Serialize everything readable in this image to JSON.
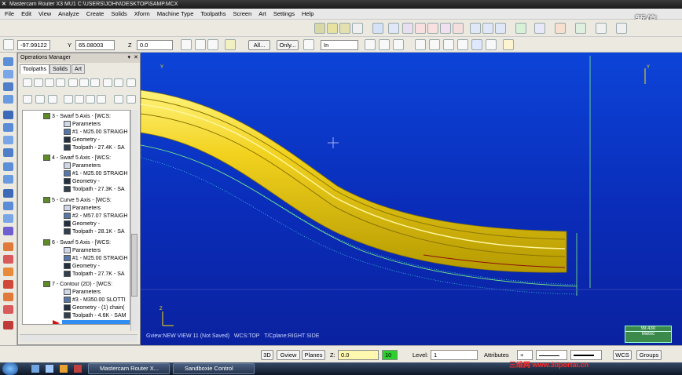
{
  "window": {
    "title": "Mastercam Router X3 MU1   C:\\USERS\\JOHN\\DESKTOP\\SAMP.MCX",
    "overlay_label": "暂停"
  },
  "menu": [
    "File",
    "Edit",
    "View",
    "Analyze",
    "Create",
    "Solids",
    "Xform",
    "Machine Type",
    "Toolpaths",
    "Screen",
    "Art",
    "Settings",
    "Help"
  ],
  "coords": {
    "x_label": "X",
    "x_value": "-97.99122",
    "y_label": "Y",
    "y_value": "65.08003",
    "z_label": "Z",
    "z_value": "0.0"
  },
  "selection": {
    "all_button": "All...",
    "only_button": "Only...",
    "mode_value": "In"
  },
  "ops_manager": {
    "title": "Operations Manager",
    "tabs": [
      "Toolpaths",
      "Solids",
      "Art"
    ],
    "tree": [
      {
        "text": "3 - Swarf 5 Axis - [WCS: ",
        "level": 0,
        "icon": "folder-icon"
      },
      {
        "text": "Parameters",
        "level": 1,
        "icon": "parameters-icon"
      },
      {
        "text": "#1 - M25.00 STRAIGH",
        "level": 1,
        "icon": "tool-icon"
      },
      {
        "text": "Geometry -",
        "level": 1,
        "icon": "geometry-icon"
      },
      {
        "text": "Toolpath - 27.4K - SA",
        "level": 1,
        "icon": "toolpath-icon"
      },
      {
        "text": "4 - Swarf 5 Axis - [WCS: ",
        "level": 0,
        "icon": "folder-icon"
      },
      {
        "text": "Parameters",
        "level": 1,
        "icon": "parameters-icon"
      },
      {
        "text": "#1 - M25.00 STRAIGH",
        "level": 1,
        "icon": "tool-icon"
      },
      {
        "text": "Geometry -",
        "level": 1,
        "icon": "geometry-icon"
      },
      {
        "text": "Toolpath - 27.3K - SA",
        "level": 1,
        "icon": "toolpath-icon"
      },
      {
        "text": "5 - Curve 5 Axis - [WCS:",
        "level": 0,
        "icon": "folder-icon"
      },
      {
        "text": "Parameters",
        "level": 1,
        "icon": "parameters-icon"
      },
      {
        "text": "#2 - M57.07 STRAIGH",
        "level": 1,
        "icon": "tool-icon"
      },
      {
        "text": "Geometry -",
        "level": 1,
        "icon": "geometry-icon"
      },
      {
        "text": "Toolpath - 28.1K - SA",
        "level": 1,
        "icon": "toolpath-icon"
      },
      {
        "text": "6 - Swarf 5 Axis - [WCS:",
        "level": 0,
        "icon": "folder-icon"
      },
      {
        "text": "Parameters",
        "level": 1,
        "icon": "parameters-icon"
      },
      {
        "text": "#1 - M25.00 STRAIGH",
        "level": 1,
        "icon": "tool-icon"
      },
      {
        "text": "Geometry -",
        "level": 1,
        "icon": "geometry-icon"
      },
      {
        "text": "Toolpath - 27.7K - SA",
        "level": 1,
        "icon": "toolpath-icon"
      },
      {
        "text": "7 - Contour (2D) - [WCS:",
        "level": 0,
        "icon": "folder-icon"
      },
      {
        "text": "Parameters",
        "level": 1,
        "icon": "parameters-icon"
      },
      {
        "text": "#3 - M350.00 SLOTTI",
        "level": 1,
        "icon": "tool-icon"
      },
      {
        "text": "Geometry - (1) chain(",
        "level": 1,
        "icon": "geometry-icon"
      },
      {
        "text": "Toolpath - 4.6K - SAM",
        "level": 1,
        "icon": "toolpath-icon"
      }
    ]
  },
  "viewport": {
    "axis_x": "X",
    "axis_y": "Y",
    "axis_z": "Z",
    "status_gview": "Gview:NEW VIEW 11 (Not Saved)",
    "status_wcs": "WCS:TOP",
    "status_tplane": "T/Cplane:RIGHT SIDE",
    "scale_value": "99.430",
    "scale_unit": "Metric"
  },
  "statusbar": {
    "btn_3d": "3D",
    "btn_gview": "Gview",
    "btn_planes": "Planes",
    "z_label": "Z:",
    "z_value": "0.0",
    "color_value": "10",
    "level_label": "Level:",
    "level_value": "1",
    "attributes_label": "Attributes",
    "attr_value": "+",
    "wcs_label": "WCS",
    "groups_label": "Groups"
  },
  "taskbar": {
    "items": [
      "Mastercam Router X...",
      "Sandboxie Control"
    ]
  },
  "watermark": "三维网 www.3dportal.cn"
}
